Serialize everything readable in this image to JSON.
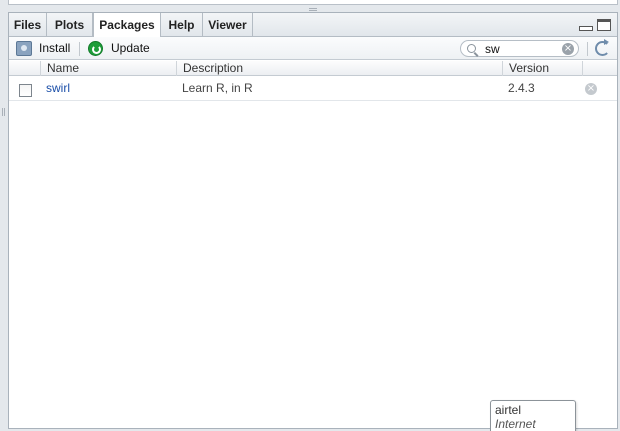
{
  "tabs": [
    {
      "label": "Files",
      "active": false
    },
    {
      "label": "Plots",
      "active": false
    },
    {
      "label": "Packages",
      "active": true
    },
    {
      "label": "Help",
      "active": false
    },
    {
      "label": "Viewer",
      "active": false
    }
  ],
  "toolbar": {
    "install_label": "Install",
    "update_label": "Update",
    "search_value": "sw",
    "clear_glyph": "×"
  },
  "table": {
    "columns": [
      "Name",
      "Description",
      "Version"
    ],
    "rows": [
      {
        "checked": false,
        "name": "swirl",
        "description": "Learn R, in R",
        "version": "2.4.3",
        "remove_glyph": "×"
      }
    ]
  },
  "tooltip": {
    "title": "airtel",
    "subtitle": "Internet access"
  },
  "colors": {
    "link": "#1a4ea8",
    "update_icon": "#1e9e3a",
    "pane_border": "#a9b2bb"
  },
  "icons": [
    "install-icon",
    "update-icon",
    "search-icon",
    "search-clear-icon",
    "refresh-icon",
    "remove-icon",
    "minimize-icon",
    "maximize-icon"
  ]
}
